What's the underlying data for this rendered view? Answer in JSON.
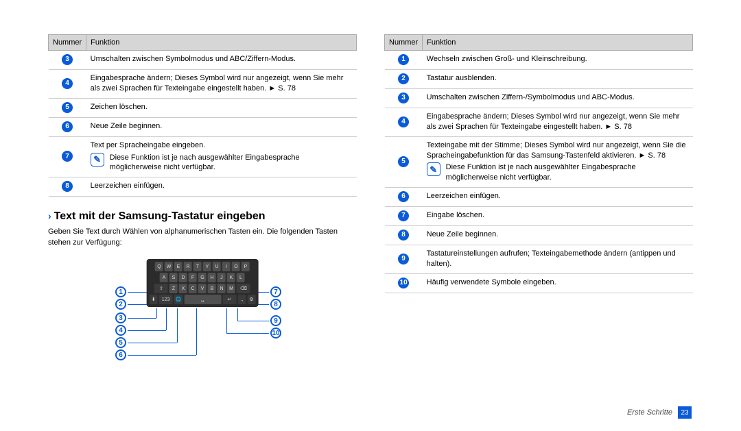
{
  "leftTable": {
    "headers": {
      "num": "Nummer",
      "func": "Funktion"
    },
    "rows": [
      {
        "n": "3",
        "t": "Umschalten zwischen Symbolmodus und ABC/Ziffern-Modus."
      },
      {
        "n": "4",
        "t": "Eingabesprache ändern; Dieses Symbol wird nur angezeigt, wenn Sie mehr als zwei Sprachen für Texteingabe eingestellt haben. ►  S. 78"
      },
      {
        "n": "5",
        "t": "Zeichen löschen."
      },
      {
        "n": "6",
        "t": "Neue Zeile beginnen."
      },
      {
        "n": "7",
        "t": "Text per Spracheingabe eingeben.",
        "note": "Diese Funktion ist je nach ausgewählter Eingabesprache möglicherweise nicht verfügbar."
      },
      {
        "n": "8",
        "t": "Leerzeichen einfügen."
      }
    ]
  },
  "heading": "Text mit der Samsung-Tastatur eingeben",
  "headingIntro": "Geben Sie Text durch Wählen von alphanumerischen Tasten ein. Die folgenden Tasten stehen zur Verfügung:",
  "keyboard": {
    "row1": [
      "Q",
      "W",
      "E",
      "R",
      "T",
      "Y",
      "U",
      "I",
      "O",
      "P"
    ],
    "row2": [
      "A",
      "S",
      "D",
      "F",
      "G",
      "H",
      "J",
      "K",
      "L"
    ],
    "row3_shift": "⇧",
    "row3": [
      "Z",
      "X",
      "C",
      "V",
      "B",
      "N",
      "M"
    ],
    "row3_del": "⌫",
    "row4": [
      "⬇",
      "123",
      "🌐",
      "␣",
      "↵",
      ".,",
      "⚙"
    ]
  },
  "callouts": {
    "l1": "1",
    "l2": "2",
    "l3": "3",
    "l4": "4",
    "l5": "5",
    "l6": "6",
    "l7": "7",
    "l8": "8",
    "l9": "9",
    "l10": "10"
  },
  "rightTable": {
    "headers": {
      "num": "Nummer",
      "func": "Funktion"
    },
    "rows": [
      {
        "n": "1",
        "t": "Wechseln zwischen Groß- und Kleinschreibung."
      },
      {
        "n": "2",
        "t": "Tastatur ausblenden."
      },
      {
        "n": "3",
        "t": "Umschalten zwischen Ziffern-/Symbolmodus und ABC-Modus."
      },
      {
        "n": "4",
        "t": "Eingabesprache ändern; Dieses Symbol wird nur angezeigt, wenn Sie mehr als zwei Sprachen für Texteingabe eingestellt haben. ►  S. 78"
      },
      {
        "n": "5",
        "t": "Texteingabe mit der Stimme; Dieses Symbol wird nur angezeigt, wenn Sie die Spracheingabefunktion für das Samsung-Tastenfeld aktivieren. ►  S. 78",
        "note": "Diese Funktion ist je nach ausgewählter Eingabesprache möglicherweise nicht verfügbar."
      },
      {
        "n": "6",
        "t": "Leerzeichen einfügen."
      },
      {
        "n": "7",
        "t": "Eingabe löschen."
      },
      {
        "n": "8",
        "t": "Neue Zeile beginnen."
      },
      {
        "n": "9",
        "t": "Tastatureinstellungen aufrufen; Texteingabemethode ändern (antippen und halten)."
      },
      {
        "n": "10",
        "t": "Häufig verwendete Symbole eingeben."
      }
    ]
  },
  "footer": {
    "section": "Erste Schritte",
    "page": "23"
  }
}
